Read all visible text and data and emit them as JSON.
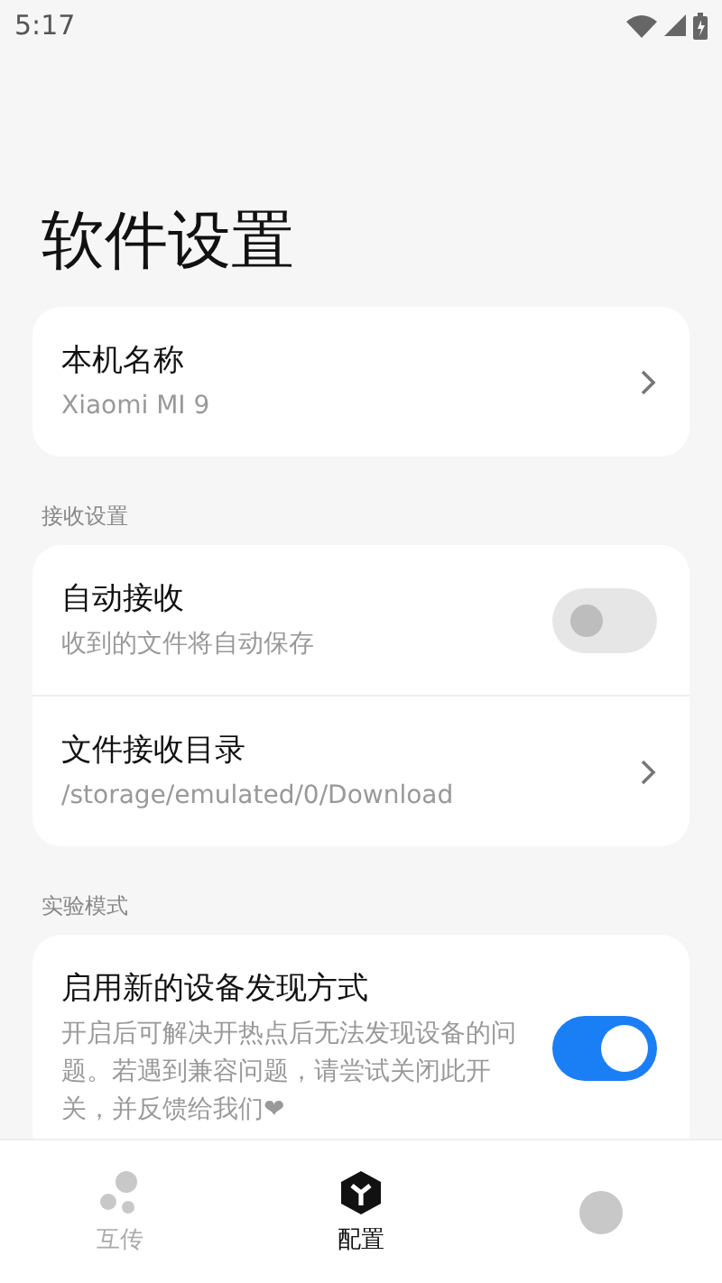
{
  "status_bar": {
    "time": "5:17"
  },
  "title": "软件设置",
  "sections": [
    {
      "items": [
        {
          "kind": "link",
          "title": "本机名称",
          "subtitle": "Xiaomi MI 9"
        }
      ]
    },
    {
      "header": "接收设置",
      "items": [
        {
          "kind": "switch",
          "title": "自动接收",
          "subtitle": "收到的文件将自动保存",
          "on": false
        },
        {
          "kind": "link",
          "title": "文件接收目录",
          "subtitle": "/storage/emulated/0/Download"
        }
      ]
    },
    {
      "header": "实验模式",
      "items": [
        {
          "kind": "switch",
          "title": "启用新的设备发现方式",
          "subtitle": "开启后可解决开热点后无法发现设备的问题。若遇到兼容问题，请尝试关闭此开关，并反馈给我们❤",
          "on": true
        }
      ]
    }
  ],
  "tabs": [
    {
      "kind": "share",
      "label": "互传",
      "selected": false
    },
    {
      "kind": "config",
      "label": "配置",
      "selected": true
    },
    {
      "kind": "other",
      "selected": false
    }
  ]
}
